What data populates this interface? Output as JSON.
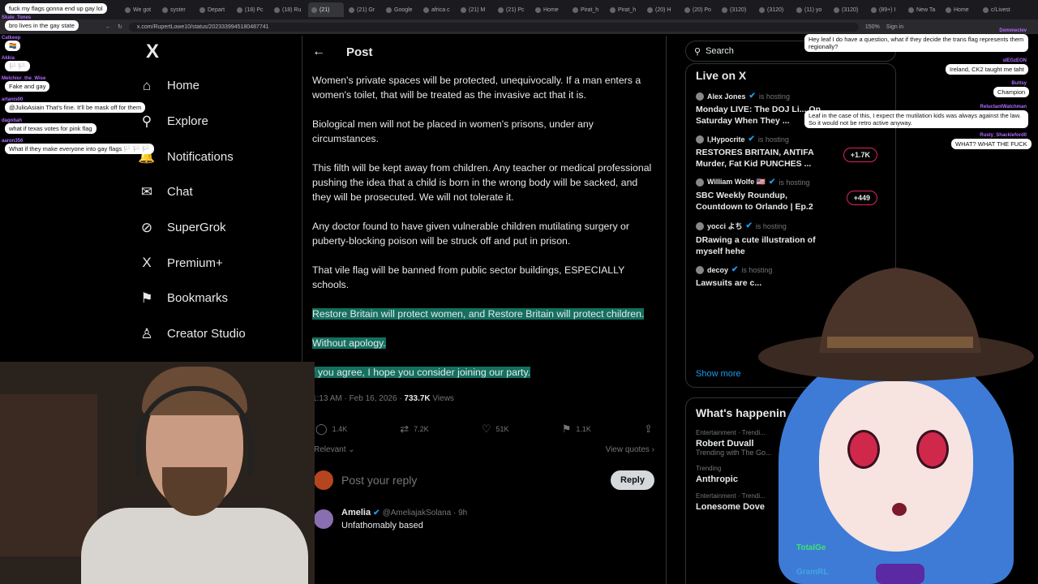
{
  "browser": {
    "tabs": [
      "We got",
      "syster",
      "Depart",
      "(18) Pc",
      "(18) Ru",
      "(21)",
      "(21) Gr",
      "Google",
      "africa c",
      "(21) M",
      "(21) Pc",
      "Home",
      "Pirat_h",
      "Pirat_h",
      "(20) H",
      "(20) Po",
      "(3120)",
      "(3120)",
      "(11) yo",
      "(3120)",
      "(89+) I",
      "New Ta",
      "Home",
      "c/Livest"
    ],
    "active_tab_index": 5,
    "url": "x.com/RupertLowe10/status/2023339945180487741",
    "zoom": "150%",
    "sign_in": "Sign in"
  },
  "nav": {
    "logo": "X",
    "items": [
      {
        "label": "Home",
        "icon": "home-icon",
        "glyph": "⌂"
      },
      {
        "label": "Explore",
        "icon": "search-icon",
        "glyph": "⚲"
      },
      {
        "label": "Notifications",
        "icon": "bell-icon",
        "glyph": "🔔"
      },
      {
        "label": "Chat",
        "icon": "mail-icon",
        "glyph": "✉"
      },
      {
        "label": "SuperGrok",
        "icon": "grok-icon",
        "glyph": "⊘"
      },
      {
        "label": "Premium+",
        "icon": "x-premium-icon",
        "glyph": "X"
      },
      {
        "label": "Bookmarks",
        "icon": "bookmark-icon",
        "glyph": "⚑"
      },
      {
        "label": "Creator Studio",
        "icon": "creator-icon",
        "glyph": "♙"
      }
    ]
  },
  "post": {
    "header": "Post",
    "paragraphs": [
      "Women's private spaces will be protected, unequivocally. If a man enters a women's toilet, that will be treated as the invasive act that it is.",
      "Biological men will not be placed in women's prisons, under any circumstances.",
      "This filth will be kept away from children. Any teacher or medical professional pushing the idea that a child is born in the wrong body will be sacked, and they will be prosecuted. We will not tolerate it.",
      "Any doctor found to have given vulnerable children mutilating surgery or puberty-blocking poison will be struck off and put in prison.",
      "That vile flag will be banned from public sector buildings, ESPECIALLY schools."
    ],
    "highlighted": [
      "Restore Britain will protect women, and Restore Britain will protect children.",
      "Without apology.",
      "f you agree, I hope you consider joining our party."
    ],
    "time": "1:13 AM · Feb 16, 2026 · ",
    "views_count": "733.7K",
    "views_label": " Views",
    "replies": "1.4K",
    "reposts": "7.2K",
    "likes": "51K",
    "bookmarks": "1.1K",
    "sort": "Relevant ⌄",
    "view_quotes": "View quotes ›",
    "reply_placeholder": "Post your reply",
    "reply_button": "Reply",
    "first_reply": {
      "name": "Amelia",
      "handle": "@AmeliajakSolana · 9h",
      "text": "Unfathomably based"
    }
  },
  "sidebar": {
    "search_placeholder": "Search",
    "live_title": "Live on X",
    "live": [
      {
        "host": "Alex Jones",
        "hosting": "is hosting",
        "title": "Monday LIVE: The DOJ Li... On Saturday When They ...",
        "count": ""
      },
      {
        "host": "I,Hypocrite",
        "hosting": "is hosting",
        "title": "RESTORES BRITAIN, ANTIFA Murder, Fat Kid PUNCHES ...",
        "count": "+1.7K"
      },
      {
        "host": "William Wolfe 🇺🇸",
        "hosting": "is hosting",
        "title": "SBC Weekly Roundup, Countdown to Orlando | Ep.2",
        "count": "+449"
      },
      {
        "host": "yocci よち",
        "hosting": "is hosting",
        "title": "DRawing a cute illustration of myself hehe",
        "count": ""
      },
      {
        "host": "decoy",
        "hosting": "is hosting",
        "title": "Lawsuits are c...",
        "count": ""
      }
    ],
    "show_more": "Show more",
    "happening_title": "What's happenin",
    "trends": [
      {
        "cat": "Entertainment · Trendi...",
        "title": "Robert Duvall",
        "sub": "Trending with The Go..."
      },
      {
        "cat": "Trending",
        "title": "Anthropic",
        "sub": ""
      },
      {
        "cat": "Entertainment · Trendi...",
        "title": "Lonesome Dove",
        "sub": ""
      }
    ]
  },
  "chat_left": [
    {
      "text": "fuck my flags gonna end up gay lol",
      "user": ""
    },
    {
      "text": "bro lives in the gay state",
      "user": "Skale_Tones"
    },
    {
      "text": "🏳️‍🌈",
      "user": "Catkeep"
    },
    {
      "text": "🏳️ 🏳️",
      "user": "Akkia"
    },
    {
      "text": "Fake and gay",
      "user": "Melchior_the_Wise"
    },
    {
      "text": "@JulioAsiain That's fine. It'll be mask off for them",
      "user": "artanis00"
    },
    {
      "text": "what if texas votes for pink flag",
      "user": "dagobah"
    },
    {
      "text": "What if they make everyone into gay flags 🏳️ 🏳️ 🏳️",
      "user": "aaron356"
    }
  ],
  "chat_right": [
    {
      "text": "Hey leaf I do have a question, what if they decide the trans flag represents them regionally?",
      "user": "Dommeclev"
    },
    {
      "text": "Ireland, CK2 taught me taht",
      "user": "sIEGzEON"
    },
    {
      "text": "Champion",
      "user": "Buttsy"
    },
    {
      "text": "Leaf in the case of this, I expect the mutilation kids was always against the law. So it would not be retro active anyway.",
      "user": "ReluctantWatchman"
    },
    {
      "text": "WHAT? WHAT THE FUCK",
      "user": "Rusty_Shackleford0"
    }
  ],
  "stream_overlay": {
    "name1": "TotalGe",
    "name2": "GramRL"
  },
  "colors": {
    "highlight": "#14705f",
    "verified": "#1d9bf0",
    "background": "#000000"
  }
}
